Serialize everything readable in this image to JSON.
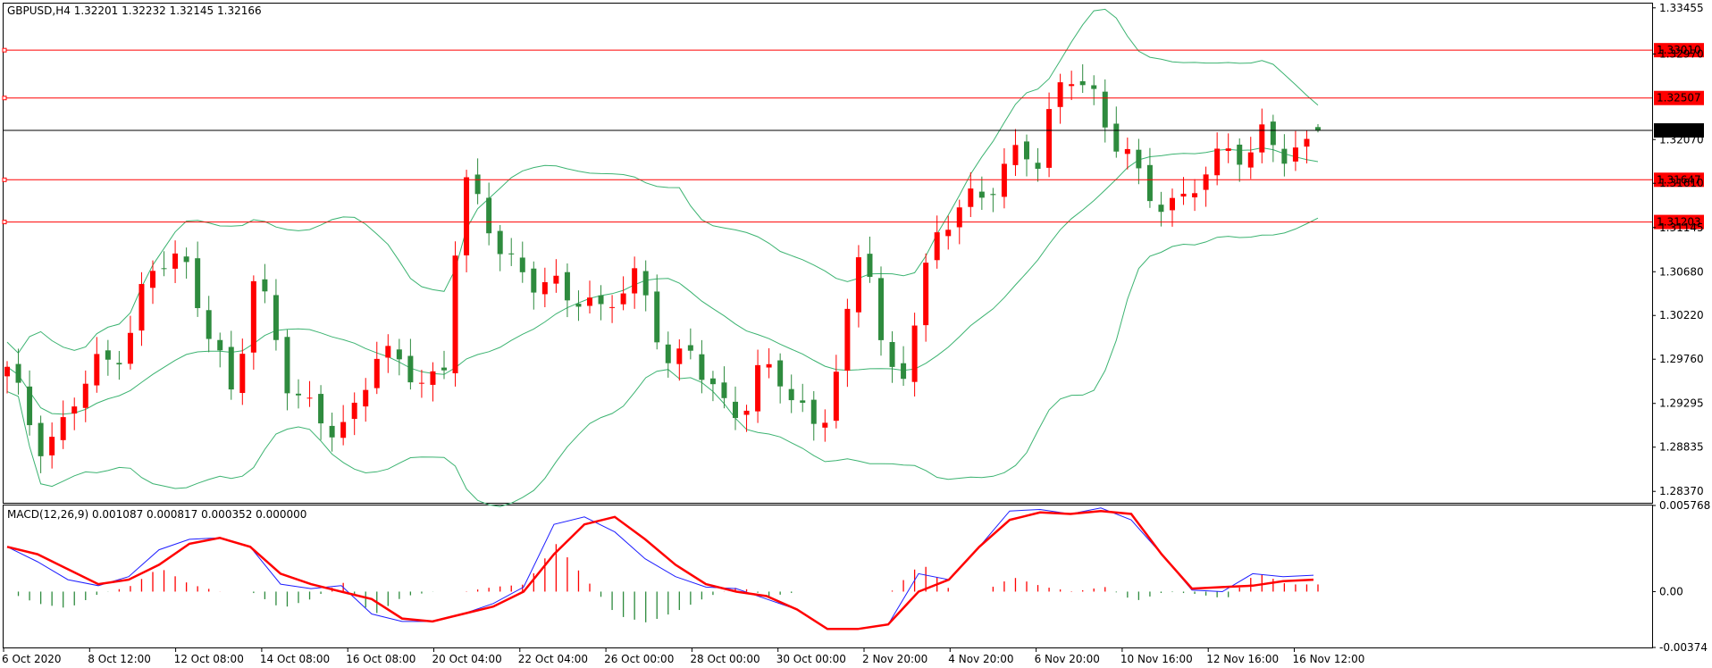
{
  "header": {
    "symbol_line": "GBPUSD,H4  1.32201 1.32232 1.32145 1.32166"
  },
  "macd_header": {
    "label": "MACD(12,26,9) 0.001087 0.000817 0.000352 0.000000"
  },
  "colors": {
    "background": "#ffffff",
    "bull_candle": "#ff0000",
    "bear_candle": "#2e8b3e",
    "bands": "#3cb371",
    "level_lines": "#ff0000",
    "price_line": "#000000",
    "macd_main": "#1e1eff",
    "macd_signal": "#ff0000",
    "hist_pos": "#ff0000",
    "hist_neg": "#2e8b3e"
  },
  "price_axis": {
    "ticks": [
      "1.33455",
      "1.32970",
      "1.32070",
      "1.31610",
      "1.31145",
      "1.30680",
      "1.30220",
      "1.29760",
      "1.29295",
      "1.28835",
      "1.28370"
    ]
  },
  "levels": [
    {
      "label": "1.33010",
      "value": 1.3301
    },
    {
      "label": "1.32507",
      "value": 1.32507
    },
    {
      "label": "1.31647",
      "value": 1.31647
    },
    {
      "label": "1.31203",
      "value": 1.31203
    }
  ],
  "current_price": {
    "label": "1.32166",
    "value": 1.32166
  },
  "macd_axis": {
    "ticks": [
      "0.005768",
      "0.00",
      "-0.00374"
    ]
  },
  "time_axis": {
    "labels": [
      "6 Oct 2020",
      "8 Oct 12:00",
      "12 Oct 08:00",
      "14 Oct 08:00",
      "16 Oct 08:00",
      "20 Oct 04:00",
      "22 Oct 04:00",
      "26 Oct 00:00",
      "28 Oct 00:00",
      "30 Oct 00:00",
      "2 Nov 20:00",
      "4 Nov 20:00",
      "6 Nov 20:00",
      "10 Nov 16:00",
      "12 Nov 16:00",
      "16 Nov 12:00"
    ]
  },
  "chart_data": {
    "type": "candlestick",
    "symbol": "GBPUSD",
    "timeframe": "H4",
    "ohlc_last": {
      "open": 1.32201,
      "high": 1.32232,
      "low": 1.32145,
      "close": 1.32166
    },
    "ylim": [
      1.2825,
      1.335
    ],
    "close_path": [
      1.296,
      1.292,
      1.289,
      1.29,
      1.2935,
      1.2965,
      1.2975,
      1.301,
      1.306,
      1.3075,
      1.308,
      1.304,
      1.299,
      1.292,
      1.306,
      1.303,
      1.296,
      1.2925,
      1.2905,
      1.2895,
      1.2935,
      1.2985,
      1.297,
      1.296,
      1.295,
      1.2975,
      1.3165,
      1.313,
      1.31,
      1.308,
      1.306,
      1.305,
      1.3035,
      1.305,
      1.303,
      1.3045,
      1.3055,
      1.3015,
      1.2975,
      1.299,
      1.295,
      1.292,
      1.2925,
      1.297,
      1.296,
      1.2925,
      1.2905,
      1.2935,
      1.301,
      1.311,
      1.2985,
      1.295,
      1.303,
      1.3095,
      1.312,
      1.3145,
      1.316,
      1.3175,
      1.319,
      1.318,
      1.3265,
      1.3285,
      1.325,
      1.3205,
      1.32,
      1.3165,
      1.314,
      1.3125,
      1.316,
      1.319,
      1.3205,
      1.318,
      1.321,
      1.3195,
      1.32,
      1.3216
    ],
    "macd_main_path": [
      0.003,
      0.002,
      0.0008,
      0.0004,
      0.001,
      0.0028,
      0.0035,
      0.0036,
      0.003,
      0.0005,
      0.0002,
      0.0004,
      -0.0015,
      -0.002,
      -0.002,
      -0.0015,
      -0.0008,
      0.0003,
      0.0045,
      0.005,
      0.004,
      0.0022,
      0.001,
      0.0003,
      0.0002,
      -0.0005,
      -0.0012,
      -0.0025,
      -0.0025,
      -0.0022,
      0.0012,
      0.0008,
      0.003,
      0.0054,
      0.0055,
      0.0052,
      0.0056,
      0.0048,
      0.0025,
      0.0001,
      0.0,
      0.0012,
      0.001,
      0.0011
    ],
    "macd_signal_path": [
      0.003,
      0.0025,
      0.0015,
      0.0005,
      0.0008,
      0.0018,
      0.0032,
      0.0036,
      0.003,
      0.0012,
      0.0005,
      0.0,
      -0.0005,
      -0.0018,
      -0.002,
      -0.0015,
      -0.001,
      0.0,
      0.0025,
      0.0045,
      0.005,
      0.0035,
      0.0018,
      0.0005,
      0.0,
      -0.0003,
      -0.0012,
      -0.0025,
      -0.0025,
      -0.0022,
      0.0,
      0.0008,
      0.003,
      0.0048,
      0.0053,
      0.0052,
      0.0054,
      0.0052,
      0.0025,
      0.0002,
      0.0003,
      0.0004,
      0.0007,
      0.0008
    ],
    "macd_ylim": [
      -0.00374,
      0.005768
    ]
  }
}
